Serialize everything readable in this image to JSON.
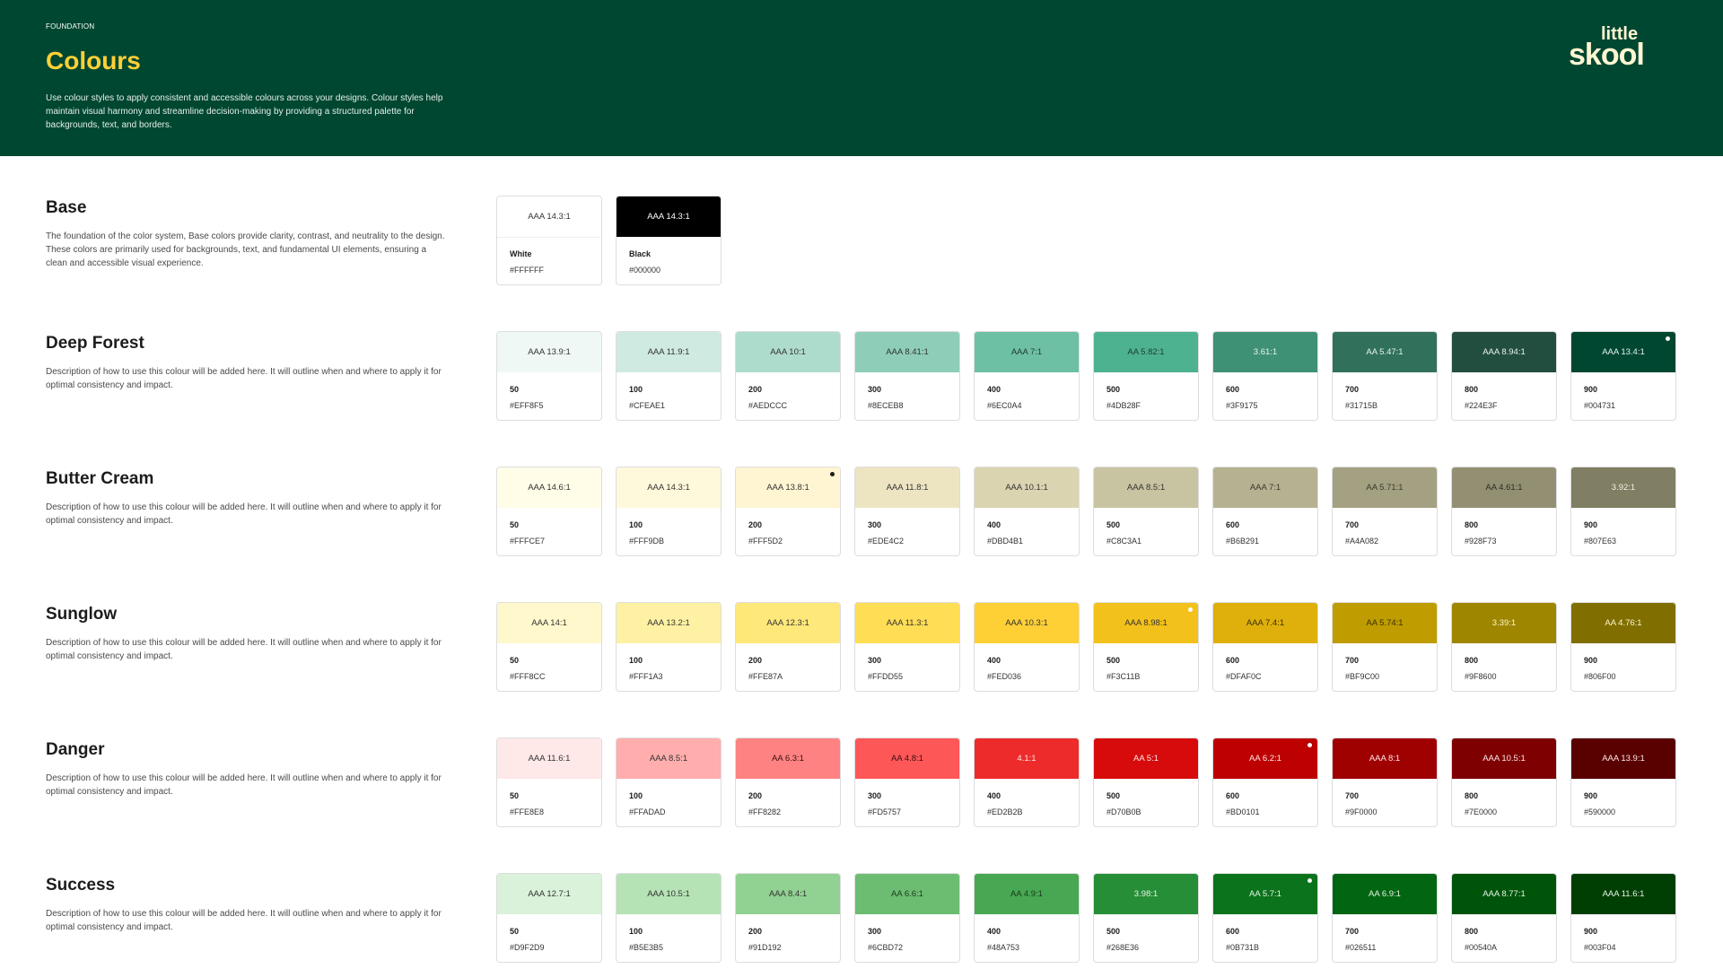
{
  "header": {
    "eyebrow": "FOUNDATION",
    "title": "Colours",
    "description": "Use colour styles to apply consistent and accessible colours across your designs. Colour styles help maintain visual harmony and streamline decision-making by providing a structured palette for backgrounds, text, and borders.",
    "logo_text": [
      "little",
      "skool"
    ],
    "background": "#004731",
    "accent": "#FED036"
  },
  "sections": [
    {
      "title": "Base",
      "description": "The foundation of the color system, Base colors provide clarity, contrast, and neutrality to the design. These colors are primarily used for backgrounds, text, and fundamental UI elements, ensuring a clean and accessible visual experience.",
      "swatches": [
        {
          "name": "White",
          "hex": "#FFFFFF",
          "ratio": "AAA 14.3:1",
          "text": "#333333"
        },
        {
          "name": "Black",
          "hex": "#000000",
          "ratio": "AAA 14.3:1",
          "text": "#ffffff"
        }
      ]
    },
    {
      "title": "Deep Forest",
      "description": "Description of how to use this colour will be added here. It will outline when and where to apply it for optimal consistency and impact.",
      "swatches": [
        {
          "name": "50",
          "hex": "#EFF8F5",
          "ratio": "AAA 13.9:1",
          "text": "#333333"
        },
        {
          "name": "100",
          "hex": "#CFEAE1",
          "ratio": "AAA 11.9:1",
          "text": "#333333"
        },
        {
          "name": "200",
          "hex": "#AEDCCC",
          "ratio": "AAA 10:1",
          "text": "#333333"
        },
        {
          "name": "300",
          "hex": "#8ECEB8",
          "ratio": "AAA 8.41:1",
          "text": "#333333"
        },
        {
          "name": "400",
          "hex": "#6EC0A4",
          "ratio": "AAA 7:1",
          "text": "#1f3b31"
        },
        {
          "name": "500",
          "hex": "#4DB28F",
          "ratio": "AA 5.82:1",
          "text": "#1f3b31"
        },
        {
          "name": "600",
          "hex": "#3F9175",
          "ratio": "3.61:1",
          "text": "#e8f3ee"
        },
        {
          "name": "700",
          "hex": "#31715B",
          "ratio": "AA 5.47:1",
          "text": "#e8f3ee"
        },
        {
          "name": "800",
          "hex": "#224E3F",
          "ratio": "AAA 8.94:1",
          "text": "#e8f3ee"
        },
        {
          "name": "900",
          "hex": "#004731",
          "ratio": "AAA 13.4:1",
          "text": "#e8f3ee",
          "dot": "#ffffff"
        }
      ]
    },
    {
      "title": "Butter Cream",
      "description": "Description of how to use this colour will be added here. It will outline when and where to apply it for optimal consistency and impact.",
      "swatches": [
        {
          "name": "50",
          "hex": "#FFFCE7",
          "ratio": "AAA 14.6:1",
          "text": "#333333"
        },
        {
          "name": "100",
          "hex": "#FFF9DB",
          "ratio": "AAA 14.3:1",
          "text": "#333333"
        },
        {
          "name": "200",
          "hex": "#FFF5D2",
          "ratio": "AAA 13.8:1",
          "text": "#333333",
          "dot": "#1c1c1c"
        },
        {
          "name": "300",
          "hex": "#EDE4C2",
          "ratio": "AAA 11.8:1",
          "text": "#333333"
        },
        {
          "name": "400",
          "hex": "#DBD4B1",
          "ratio": "AAA 10.1:1",
          "text": "#333333"
        },
        {
          "name": "500",
          "hex": "#C8C3A1",
          "ratio": "AAA 8.5:1",
          "text": "#333333"
        },
        {
          "name": "600",
          "hex": "#B6B291",
          "ratio": "AAA 7:1",
          "text": "#3a3a2a"
        },
        {
          "name": "700",
          "hex": "#A4A082",
          "ratio": "AA 5.71:1",
          "text": "#3a3a2a"
        },
        {
          "name": "800",
          "hex": "#928F73",
          "ratio": "AA 4.61:1",
          "text": "#2e2e22"
        },
        {
          "name": "900",
          "hex": "#807E63",
          "ratio": "3.92:1",
          "text": "#f4f2e6"
        }
      ]
    },
    {
      "title": "Sunglow",
      "description": "Description of how to use this colour will be added here. It will outline when and where to apply it for optimal consistency and impact.",
      "swatches": [
        {
          "name": "50",
          "hex": "#FFF8CC",
          "ratio": "AAA 14:1",
          "text": "#333333"
        },
        {
          "name": "100",
          "hex": "#FFF1A3",
          "ratio": "AAA 13.2:1",
          "text": "#333333"
        },
        {
          "name": "200",
          "hex": "#FFE87A",
          "ratio": "AAA 12.3:1",
          "text": "#333333"
        },
        {
          "name": "300",
          "hex": "#FFDD55",
          "ratio": "AAA 11.3:1",
          "text": "#333333"
        },
        {
          "name": "400",
          "hex": "#FED036",
          "ratio": "AAA 10.3:1",
          "text": "#333333"
        },
        {
          "name": "500",
          "hex": "#F3C11B",
          "ratio": "AAA 8.98:1",
          "text": "#333333",
          "dot": "#ffffff"
        },
        {
          "name": "600",
          "hex": "#DFAF0C",
          "ratio": "AAA 7.4:1",
          "text": "#3a3000"
        },
        {
          "name": "700",
          "hex": "#BF9C00",
          "ratio": "AA 5.74:1",
          "text": "#3a3000"
        },
        {
          "name": "800",
          "hex": "#9F8600",
          "ratio": "3.39:1",
          "text": "#fff6cc"
        },
        {
          "name": "900",
          "hex": "#806F00",
          "ratio": "AA 4.76:1",
          "text": "#fff6cc"
        }
      ]
    },
    {
      "title": "Danger",
      "description": "Description of how to use this colour will be added here. It will outline when and where to apply it for optimal consistency and impact.",
      "swatches": [
        {
          "name": "50",
          "hex": "#FFE8E8",
          "ratio": "AAA 11.6:1",
          "text": "#333333"
        },
        {
          "name": "100",
          "hex": "#FFADAD",
          "ratio": "AAA 8.5:1",
          "text": "#333333"
        },
        {
          "name": "200",
          "hex": "#FF8282",
          "ratio": "AA 6.3:1",
          "text": "#3a1010"
        },
        {
          "name": "300",
          "hex": "#FD5757",
          "ratio": "AA 4.8:1",
          "text": "#3a1010"
        },
        {
          "name": "400",
          "hex": "#ED2B2B",
          "ratio": "4.1:1",
          "text": "#ffe8e8"
        },
        {
          "name": "500",
          "hex": "#D70B0B",
          "ratio": "AA 5:1",
          "text": "#ffe8e8"
        },
        {
          "name": "600",
          "hex": "#BD0101",
          "ratio": "AA 6.2:1",
          "text": "#ffe8e8",
          "dot": "#ffffff"
        },
        {
          "name": "700",
          "hex": "#9F0000",
          "ratio": "AAA 8:1",
          "text": "#ffe8e8"
        },
        {
          "name": "800",
          "hex": "#7E0000",
          "ratio": "AAA 10.5:1",
          "text": "#ffe8e8"
        },
        {
          "name": "900",
          "hex": "#590000",
          "ratio": "AAA 13.9:1",
          "text": "#ffe8e8"
        }
      ]
    },
    {
      "title": "Success",
      "description": "Description of how to use this colour will be added here. It will outline when and where to apply it for optimal consistency and impact.",
      "swatches": [
        {
          "name": "50",
          "hex": "#D9F2D9",
          "ratio": "AAA 12.7:1",
          "text": "#333333"
        },
        {
          "name": "100",
          "hex": "#B5E3B5",
          "ratio": "AAA 10.5:1",
          "text": "#333333"
        },
        {
          "name": "200",
          "hex": "#91D192",
          "ratio": "AAA 8.4:1",
          "text": "#333333"
        },
        {
          "name": "300",
          "hex": "#6CBD72",
          "ratio": "AA 6.6:1",
          "text": "#1a3a1c"
        },
        {
          "name": "400",
          "hex": "#48A753",
          "ratio": "AA 4.9:1",
          "text": "#1a3a1c"
        },
        {
          "name": "500",
          "hex": "#268E36",
          "ratio": "3.98:1",
          "text": "#e6f5e6"
        },
        {
          "name": "600",
          "hex": "#0B731B",
          "ratio": "AA 5.7:1",
          "text": "#e6f5e6",
          "dot": "#ffffff"
        },
        {
          "name": "700",
          "hex": "#026511",
          "ratio": "AA 6.9:1",
          "text": "#e6f5e6"
        },
        {
          "name": "800",
          "hex": "#00540A",
          "ratio": "AAA 8.77:1",
          "text": "#e6f5e6"
        },
        {
          "name": "900",
          "hex": "#003F04",
          "ratio": "AAA 11.6:1",
          "text": "#e6f5e6"
        }
      ]
    }
  ]
}
